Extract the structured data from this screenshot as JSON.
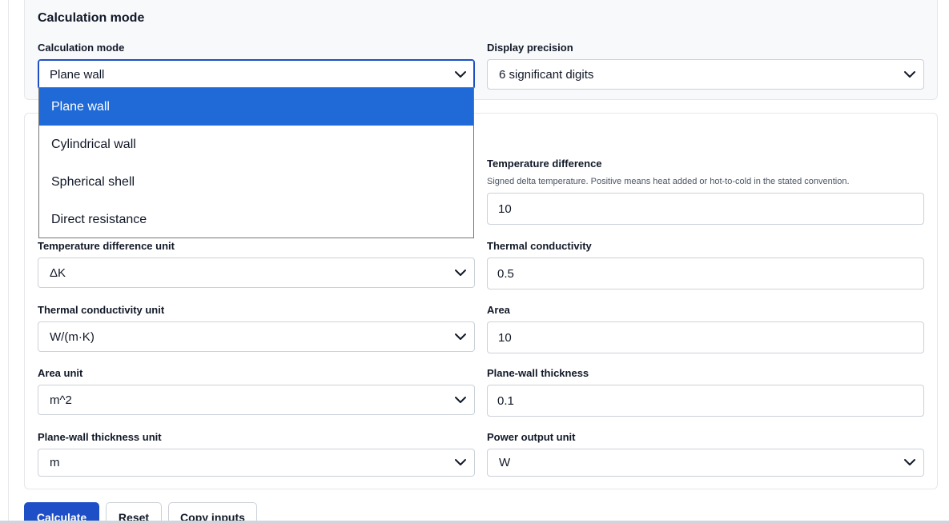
{
  "mode_section": {
    "title": "Calculation mode",
    "mode_label": "Calculation mode",
    "mode_value": "Plane wall",
    "precision_label": "Display precision",
    "precision_value": "6 significant digits"
  },
  "mode_dropdown": {
    "options": [
      "Plane wall",
      "Cylindrical wall",
      "Spherical shell",
      "Direct resistance"
    ],
    "selected_index": 0
  },
  "inputs": {
    "temp_diff": {
      "label": "Temperature difference",
      "hint": "Signed delta temperature. Positive means heat added or hot-to-cold in the stated convention.",
      "value": "10"
    },
    "temp_diff_unit": {
      "label": "Temperature difference unit",
      "value": "ΔK"
    },
    "conductivity": {
      "label": "Thermal conductivity",
      "value": "0.5"
    },
    "conductivity_unit": {
      "label": "Thermal conductivity unit",
      "value": "W/(m·K)"
    },
    "area": {
      "label": "Area",
      "value": "10"
    },
    "area_unit": {
      "label": "Area unit",
      "value": "m^2"
    },
    "thickness": {
      "label": "Plane-wall thickness",
      "value": "0.1"
    },
    "thickness_unit": {
      "label": "Plane-wall thickness unit",
      "value": "m"
    },
    "power_unit": {
      "label": "Power output unit",
      "value": "W"
    }
  },
  "actions": {
    "calculate": "Calculate",
    "reset": "Reset",
    "copy": "Copy inputs"
  },
  "colors": {
    "accent": "#1e4fc6",
    "selected_option": "#1f6ad6",
    "panel_bg": "#f8f9fb"
  },
  "icons": {
    "select_arrow": "chevron-down-icon"
  }
}
